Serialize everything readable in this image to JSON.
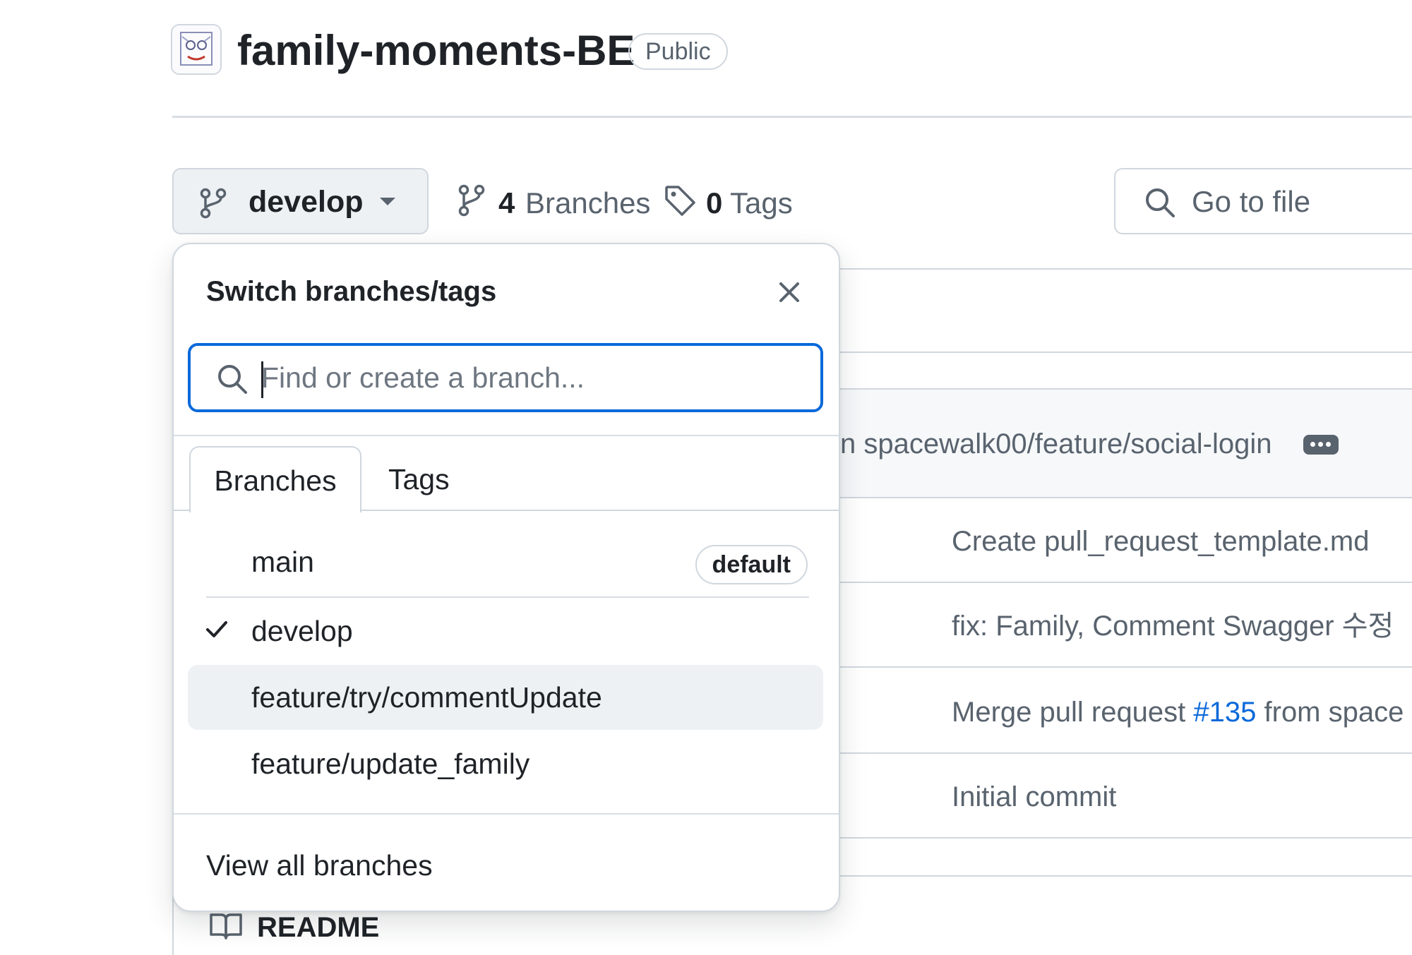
{
  "repo": {
    "name": "family-moments-BE",
    "visibility": "Public"
  },
  "toolbar": {
    "current_branch": "develop",
    "branches_count": "4",
    "branches_label": "Branches",
    "tags_count": "0",
    "tags_label": "Tags",
    "goto_file_placeholder": "Go to file"
  },
  "dropdown": {
    "title": "Switch branches/tags",
    "search_placeholder": "Find or create a branch...",
    "tabs": [
      {
        "label": "Branches",
        "active": true
      },
      {
        "label": "Tags",
        "active": false
      }
    ],
    "branches": [
      {
        "name": "main",
        "badge": "default",
        "selected": false
      },
      {
        "name": "develop",
        "badge": "",
        "selected": true
      },
      {
        "name": "feature/try/commentUpdate",
        "badge": "",
        "selected": false
      },
      {
        "name": "feature/update_family",
        "badge": "",
        "selected": false
      }
    ],
    "view_all_label": "View all branches"
  },
  "latest_commit": {
    "text_visible": "n spacewalk00/feature/social-login"
  },
  "commit_messages": [
    {
      "text": "Create pull_request_template.md"
    },
    {
      "text": "fix: Family, Comment Swagger 수정"
    },
    {
      "prefix": "Merge pull request ",
      "pr": "#135",
      "suffix": " from space"
    },
    {
      "text": "Initial commit"
    }
  ],
  "readme": {
    "label": "README"
  },
  "colors": {
    "accent": "#0969da",
    "border": "#d0d7de",
    "muted_text": "#59636e",
    "hover_bg": "#eef1f4"
  }
}
